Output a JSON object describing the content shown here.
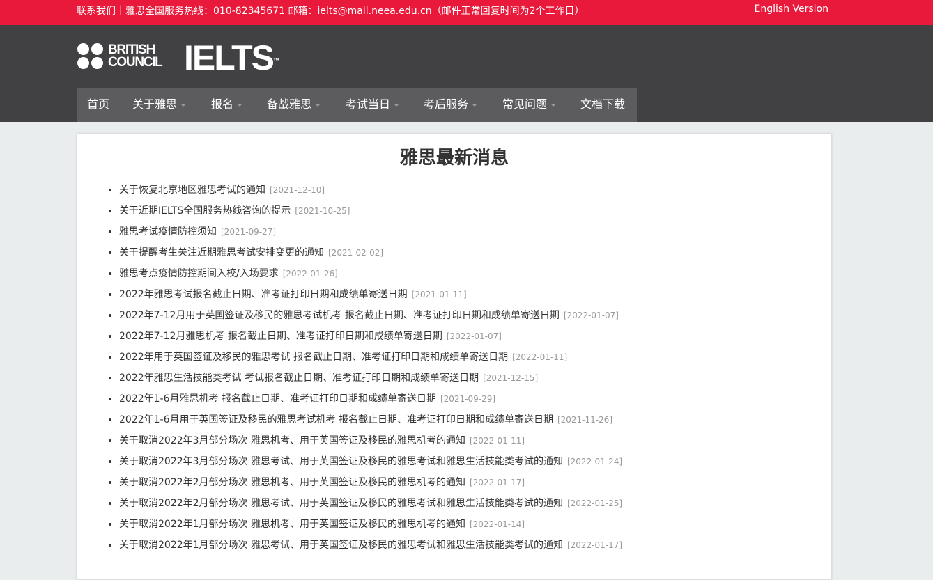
{
  "topbar": {
    "contact": "联系我们｜雅思全国服务热线：010-82345671    邮箱：ielts@mail.neea.edu.cn（邮件正常回复时间为2个工作日）",
    "english_link": "English Version",
    "color": "#e8193a"
  },
  "logo": {
    "bc_line1": "BRITISH",
    "bc_line2": "COUNCIL",
    "ielts": "IELTS",
    "tm": "™"
  },
  "nav": [
    {
      "label": "首页",
      "dropdown": false
    },
    {
      "label": "关于雅思",
      "dropdown": true
    },
    {
      "label": "报名",
      "dropdown": true
    },
    {
      "label": "备战雅思",
      "dropdown": true
    },
    {
      "label": "考试当日",
      "dropdown": true
    },
    {
      "label": "考后服务",
      "dropdown": true
    },
    {
      "label": "常见问题",
      "dropdown": true
    },
    {
      "label": "文档下载",
      "dropdown": false
    }
  ],
  "main": {
    "title": "雅思最新消息",
    "news": [
      {
        "title": "关于恢复北京地区雅思考试的通知",
        "date": "[2021-12-10]"
      },
      {
        "title": "关于近期IELTS全国服务热线咨询的提示",
        "date": "[2021-10-25]"
      },
      {
        "title": "雅思考试疫情防控须知",
        "date": "[2021-09-27]"
      },
      {
        "title": "关于提醒考生关注近期雅思考试安排变更的通知",
        "date": "[2021-02-02]"
      },
      {
        "title": "雅思考点疫情防控期间入校/入场要求",
        "date": "[2022-01-26]"
      },
      {
        "title": "2022年雅思考试报名截止日期、准考证打印日期和成绩单寄送日期",
        "date": "[2021-01-11]"
      },
      {
        "title": "2022年7-12月用于英国签证及移民的雅思考试机考 报名截止日期、准考证打印日期和成绩单寄送日期",
        "date": "[2022-01-07]"
      },
      {
        "title": "2022年7-12月雅思机考 报名截止日期、准考证打印日期和成绩单寄送日期",
        "date": "[2022-01-07]"
      },
      {
        "title": "2022年用于英国签证及移民的雅思考试 报名截止日期、准考证打印日期和成绩单寄送日期",
        "date": "[2022-01-11]"
      },
      {
        "title": "2022年雅思生活技能类考试 考试报名截止日期、准考证打印日期和成绩单寄送日期",
        "date": "[2021-12-15]"
      },
      {
        "title": "2022年1-6月雅思机考 报名截止日期、准考证打印日期和成绩单寄送日期",
        "date": "[2021-09-29]"
      },
      {
        "title": "2022年1-6月用于英国签证及移民的雅思考试机考 报名截止日期、准考证打印日期和成绩单寄送日期",
        "date": "[2021-11-26]"
      },
      {
        "title": "关于取消2022年3月部分场次 雅思机考、用于英国签证及移民的雅思机考的通知",
        "date": "[2022-01-11]"
      },
      {
        "title": "关于取消2022年3月部分场次 雅思考试、用于英国签证及移民的雅思考试和雅思生活技能类考试的通知",
        "date": "[2022-01-24]"
      },
      {
        "title": "关于取消2022年2月部分场次 雅思机考、用于英国签证及移民的雅思机考的通知",
        "date": "[2022-01-17]"
      },
      {
        "title": "关于取消2022年2月部分场次 雅思考试、用于英国签证及移民的雅思考试和雅思生活技能类考试的通知",
        "date": "[2022-01-25]"
      },
      {
        "title": "关于取消2022年1月部分场次 雅思机考、用于英国签证及移民的雅思机考的通知",
        "date": "[2022-01-14]"
      },
      {
        "title": "关于取消2022年1月部分场次 雅思考试、用于英国签证及移民的雅思考试和雅思生活技能类考试的通知",
        "date": "[2022-01-17]"
      }
    ]
  }
}
